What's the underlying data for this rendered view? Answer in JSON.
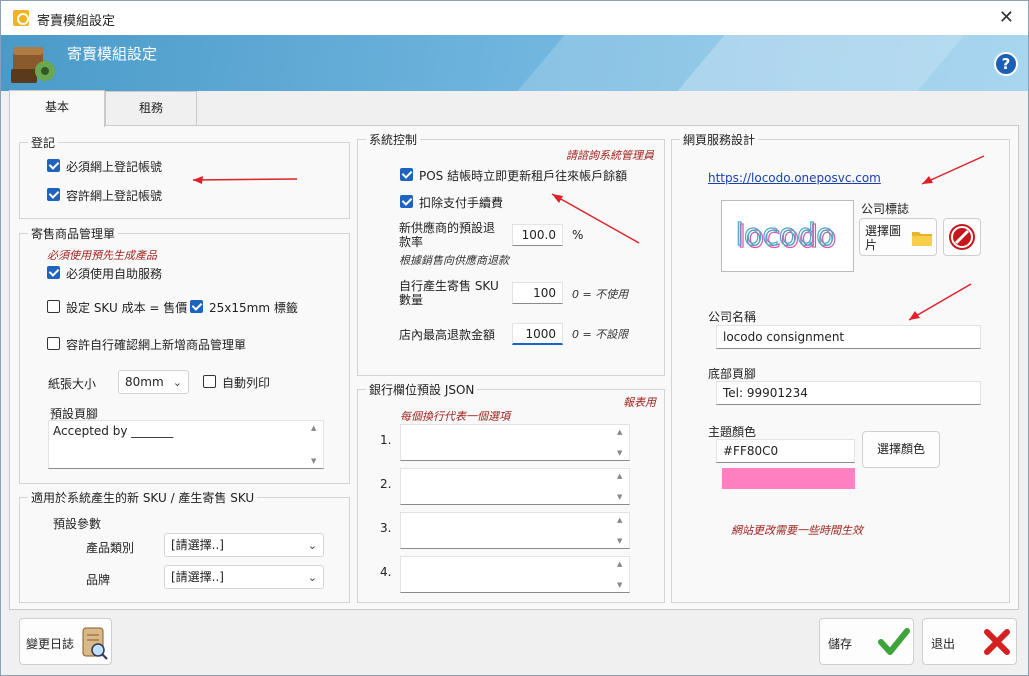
{
  "window": {
    "title": "寄賣模組設定"
  },
  "banner": {
    "title": "寄賣模組設定"
  },
  "tabs": [
    {
      "label": "基本"
    },
    {
      "label": "租務"
    }
  ],
  "registration": {
    "title": "登記",
    "must_register": "必須網上登記帳號",
    "allow_register": "容許網上登記帳號"
  },
  "consign_items": {
    "title": "寄售商品管理單",
    "note": "必須使用預先生成產品",
    "auto_service": "必須使用自助服務",
    "sku_cost": "設定 SKU 成本 = 售價",
    "label_size": "25x15mm 標籤",
    "allow_confirm": "容許自行確認網上新增商品管理單",
    "paper_label": "紙張大小",
    "paper_value": "80mm",
    "auto_print": "自動列印",
    "footer_label": "預設頁腳",
    "footer_value": "Accepted by _______"
  },
  "sku_defaults": {
    "title": "適用於系統產生的新 SKU / 產生寄售 SKU",
    "params_label": "預設參數",
    "category_label": "產品類別",
    "category_value": "[請選擇..]",
    "brand_label": "品牌",
    "brand_value": "[請選擇..]"
  },
  "system_control": {
    "title": "系統控制",
    "admin_note": "請諮詢系統管理員",
    "pos_update": "POS 結帳時立即更新租戶往來帳戶餘額",
    "deduct_fee": "扣除支付手續費",
    "supplier_refund_label": "新供應商的預設退款率",
    "supplier_refund_value": "100.0",
    "supplier_refund_unit": "%",
    "supplier_refund_note": "根據銷售向供應商退款",
    "sku_count_label": "自行產生寄售 SKU 數量",
    "sku_count_value": "100",
    "sku_count_note": "0 = 不使用",
    "max_refund_label": "店內最高退款金額",
    "max_refund_value": "1000",
    "max_refund_note": "0 = 不設限"
  },
  "bank_json": {
    "title": "銀行欄位預設 JSON",
    "report_note": "報表用",
    "line_note": "每個換行代表一個選項",
    "rows": [
      "1.",
      "2.",
      "3.",
      "4."
    ]
  },
  "web_service": {
    "title": "網頁服務設計",
    "url": "https://locodo.oneposvc.com",
    "logo_label": "公司標誌",
    "logo_text": "locodo",
    "select_image": "選擇圖片",
    "company_name_label": "公司名稱",
    "company_name_value": "locodo consignment",
    "footer_label": "底部頁腳",
    "footer_value": "Tel: 99901234",
    "theme_label": "主題顏色",
    "theme_value": "#FF80C0",
    "select_color": "選擇顏色",
    "delay_note": "網站更改需要一些時間生效"
  },
  "footer": {
    "changelog": "變更日誌",
    "save": "儲存",
    "exit": "退出"
  },
  "colors": {
    "theme": "#FF80C0",
    "accent": "#1f63c0",
    "annotation_arrow": "#e0202a"
  }
}
